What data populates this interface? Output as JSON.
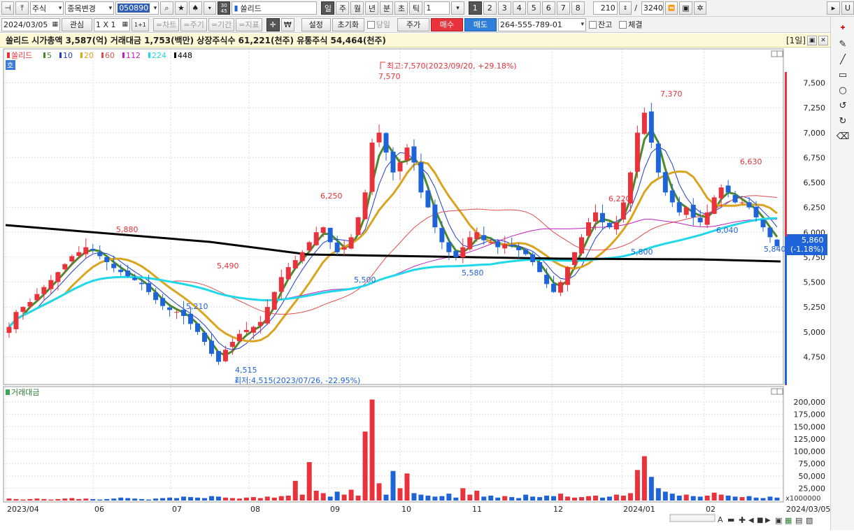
{
  "toolbar1": {
    "market_select": "주식",
    "change_select": "종목변경",
    "code_input": "050890",
    "period_badge": "30\n45",
    "stock_name": "쏠리드",
    "periods": [
      "일",
      "주",
      "월",
      "년",
      "분",
      "초",
      "틱"
    ],
    "period_count": "1",
    "layout_nums": [
      "1",
      "2",
      "3",
      "4",
      "5",
      "6",
      "7",
      "8"
    ],
    "bar_count": "210",
    "separator": "/",
    "total_count": "3240",
    "right_btn": "U"
  },
  "toolbar2": {
    "date": "2024/03/05",
    "watch_label": "관심",
    "grid_label": "1 X 1",
    "plus_label": "1+1",
    "chart_btn": "=차트",
    "cycle_btn": "=주기",
    "period_btn": "=기간",
    "indicator_btn": "=지표",
    "won_label": "₩",
    "settings_btn": "설정",
    "reset_btn": "초기화",
    "today_label": "당일",
    "price_btn": "주가",
    "buy_btn": "매수",
    "sell_btn": "매도",
    "account_select": "264-555-789-01",
    "balance_label": "잔고",
    "exec_label": "체결"
  },
  "infobar": {
    "text": "쏠리드  시가총액 3,587(억) 거래대금 1,753(백만) 상장주식수 61,221(천주) 유통주식 54,464(천주)",
    "period_tag": "[1일]"
  },
  "legend": {
    "name": "쏠리드",
    "ma": [
      {
        "label": "5",
        "color": "#4b8a2c"
      },
      {
        "label": "10",
        "color": "#1e3cc8"
      },
      {
        "label": "20",
        "color": "#d9a520"
      },
      {
        "label": "60",
        "color": "#e05050"
      },
      {
        "label": "112",
        "color": "#c020c0"
      },
      {
        "label": "224",
        "color": "#20d8e8"
      },
      {
        "label": "448",
        "color": "#000000"
      }
    ],
    "ho_badge": "호"
  },
  "colors": {
    "up": "#e8323c",
    "down": "#1e64d8"
  },
  "price_axis": {
    "ticks": [
      "7,500",
      "7,250",
      "7,000",
      "6,750",
      "6,500",
      "6,250",
      "6,000",
      "5,750",
      "5,500",
      "5,250",
      "5,000",
      "4,750"
    ]
  },
  "annotations": {
    "high_label": "최고:7,570(2023/09/20, +29.18%)",
    "high_value": "7,570",
    "low_label": "최저:4,515(2023/07/26, -22.95%)",
    "low_value": "4,515",
    "peaks": [
      "5,880",
      "5,490",
      "5,210",
      "6,250",
      "5,500",
      "5,580",
      "6,220",
      "5,800",
      "7,370",
      "6,630",
      "6,040",
      "5,840"
    ]
  },
  "current_price": {
    "value": "5,860",
    "change": "(-1.18%)"
  },
  "volume_panel": {
    "title": "거래대금",
    "ticks": [
      "200,000",
      "175,000",
      "150,000",
      "125,000",
      "100,000",
      "75,000",
      "50,000",
      "25,000"
    ],
    "unit": "x1000000"
  },
  "x_axis": {
    "labels": [
      "2023/04",
      "06",
      "07",
      "08",
      "09",
      "10",
      "11",
      "12",
      "2024/01",
      "02"
    ],
    "end_date": "2024/03/05"
  },
  "chart_data": {
    "type": "candlestick",
    "price_ylim": [
      4500,
      7700
    ],
    "price_close_series": [
      5050,
      5200,
      5250,
      5300,
      5380,
      5450,
      5520,
      5600,
      5680,
      5760,
      5800,
      5850,
      5820,
      5760,
      5700,
      5640,
      5600,
      5560,
      5520,
      5480,
      5400,
      5320,
      5260,
      5220,
      5200,
      5160,
      5080,
      5000,
      4900,
      4780,
      4700,
      4820,
      4900,
      4980,
      5020,
      5050,
      5100,
      5250,
      5400,
      5550,
      5650,
      5720,
      5800,
      5900,
      6000,
      6050,
      5900,
      5800,
      5850,
      5950,
      6150,
      6400,
      6900,
      7000,
      6800,
      6600,
      6700,
      6850,
      6700,
      6400,
      6250,
      6050,
      5900,
      5800,
      5750,
      5850,
      5950,
      6000,
      5920,
      5900,
      5850,
      5880,
      5860,
      5820,
      5780,
      5700,
      5600,
      5480,
      5400,
      5500,
      5650,
      5800,
      5950,
      6100,
      6200,
      6100,
      6050,
      6100,
      6300,
      6600,
      7000,
      7200,
      6900,
      6600,
      6400,
      6300,
      6200,
      6250,
      6150,
      6100,
      6200,
      6350,
      6450,
      6400,
      6300,
      6300,
      6250,
      6150,
      6050,
      5950,
      5860
    ],
    "volume_series": [
      4,
      3,
      2,
      3,
      4,
      3,
      2,
      3,
      4,
      5,
      3,
      4,
      3,
      2,
      3,
      4,
      6,
      5,
      4,
      3,
      2,
      4,
      5,
      6,
      5,
      8,
      7,
      6,
      5,
      9,
      8,
      6,
      5,
      4,
      6,
      7,
      5,
      8,
      6,
      9,
      10,
      40,
      12,
      78,
      20,
      15,
      8,
      18,
      12,
      22,
      10,
      140,
      205,
      35,
      12,
      60,
      25,
      55,
      15,
      12,
      10,
      8,
      9,
      14,
      6,
      25,
      12,
      20,
      8,
      10,
      6,
      9,
      7,
      5,
      12,
      8,
      7,
      10,
      9,
      14,
      8,
      6,
      7,
      9,
      10,
      6,
      8,
      12,
      10,
      15,
      62,
      90,
      48,
      25,
      18,
      14,
      10,
      12,
      9,
      8,
      10,
      16,
      12,
      10,
      8,
      7,
      9,
      6,
      5,
      8,
      6
    ],
    "volume_ylim": [
      0,
      210000
    ]
  }
}
